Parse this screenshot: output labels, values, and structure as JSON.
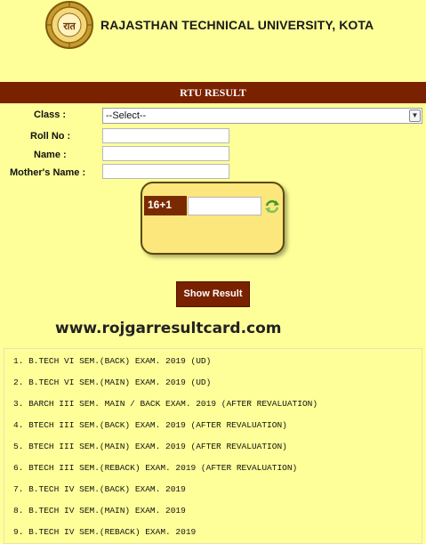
{
  "header": {
    "title": "RAJASTHAN TECHNICAL UNIVERSITY, KOTA",
    "logo_text": "रात"
  },
  "banner": {
    "title": "RTU RESULT"
  },
  "form": {
    "class_label": "Class :",
    "class_value": "--Select--",
    "rollno_label": "Roll No :",
    "name_label": "Name :",
    "mother_label": "Mother's Name :",
    "captcha_code": "16+1",
    "submit_label": "Show Result"
  },
  "watermark": "www.rojgarresultcard.com",
  "results": [
    "1. B.TECH VI SEM.(BACK) EXAM. 2019 (UD)",
    "2. B.TECH VI SEM.(MAIN) EXAM. 2019 (UD)",
    "3. BARCH III SEM. MAIN / BACK EXAM. 2019 (AFTER REVALUATION)",
    "4. BTECH III SEM.(BACK) EXAM. 2019 (AFTER REVALUATION)",
    "5. BTECH III SEM.(MAIN) EXAM. 2019 (AFTER REVALUATION)",
    "6. BTECH III SEM.(REBACK) EXAM. 2019 (AFTER REVALUATION)",
    "7. B.TECH IV SEM.(BACK) EXAM. 2019",
    "8. B.TECH IV SEM.(MAIN) EXAM. 2019",
    "9. B.TECH IV SEM.(REBACK) EXAM. 2019"
  ],
  "colors": {
    "background": "#ffff99",
    "brand": "#7a2100",
    "captcha_bg": "#fce77c"
  },
  "icons": {
    "logo": "university-seal-icon",
    "refresh": "refresh-icon"
  }
}
